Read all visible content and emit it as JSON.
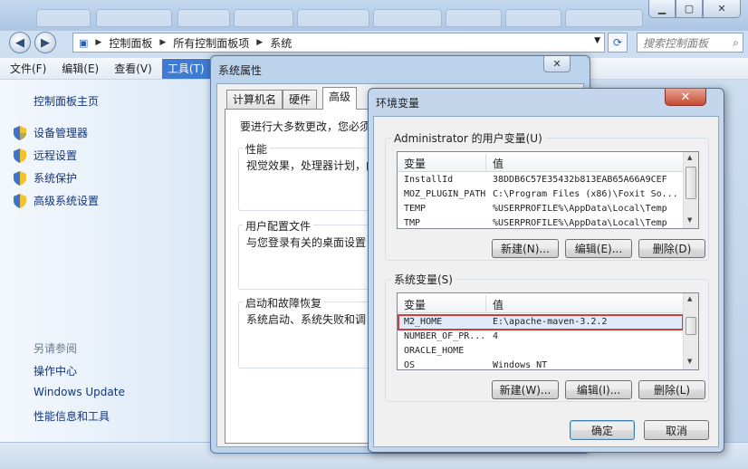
{
  "explorer": {
    "breadcrumb": [
      "控制面板",
      "所有控制面板项",
      "系统"
    ],
    "search_placeholder": "搜索控制面板",
    "menu": [
      "文件(F)",
      "编辑(E)",
      "查看(V)",
      "工具(T)"
    ],
    "left_pane": {
      "home": "控制面板主页",
      "links": [
        "设备管理器",
        "远程设置",
        "系统保护",
        "高级系统设置"
      ],
      "see_also_heading": "另请参阅",
      "see_also": [
        "操作中心",
        "Windows Update",
        "性能信息和工具"
      ]
    }
  },
  "system_properties": {
    "title": "系统属性",
    "tabs": [
      "计算机名",
      "硬件",
      "高级"
    ],
    "intro": "要进行大多数更改，您必须",
    "groups": [
      {
        "label": "性能",
        "text": "视觉效果，处理器计划，内"
      },
      {
        "label": "用户配置文件",
        "text": "与您登录有关的桌面设置"
      },
      {
        "label": "启动和故障恢复",
        "text": "系统启动、系统失败和调"
      }
    ]
  },
  "env_vars": {
    "title": "环境变量",
    "user_group_label": "Administrator 的用户变量(U)",
    "system_group_label": "系统变量(S)",
    "col_variable": "变量",
    "col_value": "值",
    "user_vars": [
      {
        "name": "InstallId",
        "value": "38DDB6C57E35432b813EAB65A66A9CEF"
      },
      {
        "name": "MOZ_PLUGIN_PATH",
        "value": "C:\\Program Files (x86)\\Foxit So..."
      },
      {
        "name": "TEMP",
        "value": "%USERPROFILE%\\AppData\\Local\\Temp"
      },
      {
        "name": "TMP",
        "value": "%USERPROFILE%\\AppData\\Local\\Temp"
      }
    ],
    "system_vars": [
      {
        "name": "M2_HOME",
        "value": "E:\\apache-maven-3.2.2"
      },
      {
        "name": "NUMBER_OF_PR...",
        "value": "4"
      },
      {
        "name": "ORACLE_HOME",
        "value": ""
      },
      {
        "name": "OS",
        "value": "Windows_NT"
      }
    ],
    "user_buttons": {
      "new": "新建(N)...",
      "edit": "编辑(E)...",
      "delete": "删除(D)"
    },
    "system_buttons": {
      "new": "新建(W)...",
      "edit": "编辑(I)...",
      "delete": "删除(L)"
    },
    "ok": "确定",
    "cancel": "取消"
  }
}
